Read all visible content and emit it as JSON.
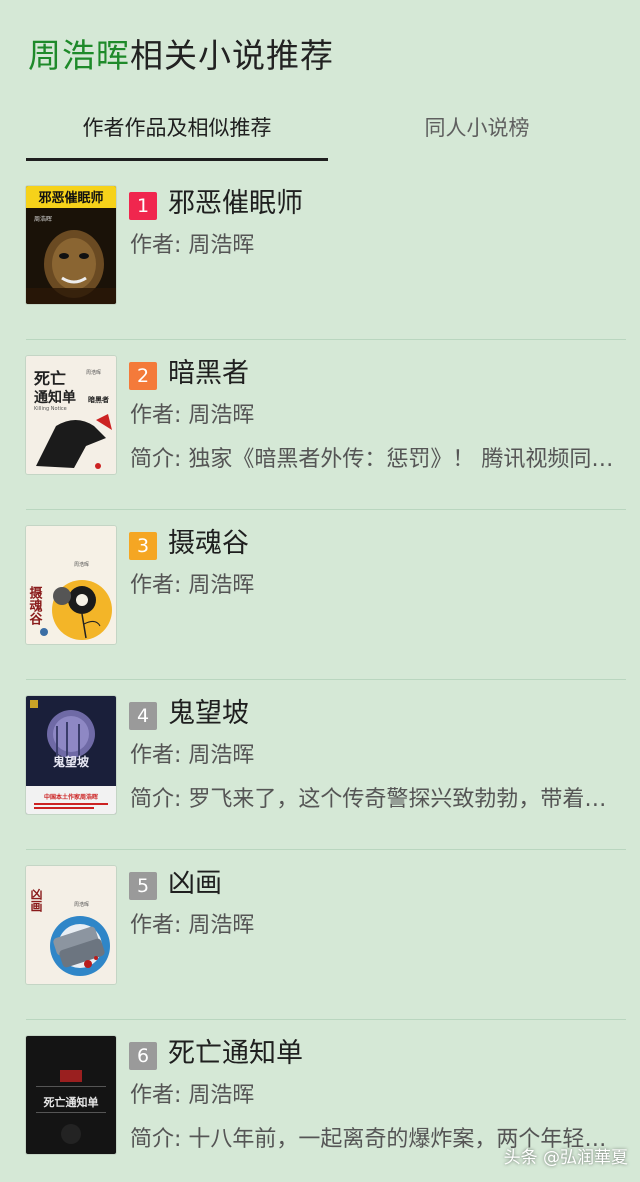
{
  "page_title": {
    "author": "周浩晖",
    "rest": "相关小说推荐"
  },
  "tabs": [
    {
      "label": "作者作品及相似推荐",
      "active": true
    },
    {
      "label": "同人小说榜",
      "active": false
    }
  ],
  "books": [
    {
      "rank": "1",
      "rank_color": "#f0264e",
      "title": "邪恶催眠师",
      "author": "作者: 周浩晖",
      "intro": ""
    },
    {
      "rank": "2",
      "rank_color": "#f47a3a",
      "title": "暗黑者",
      "author": "作者: 周浩晖",
      "intro": "简介: 独家《暗黑者外传：惩罚》！ 腾讯视频同名网剧热播中"
    },
    {
      "rank": "3",
      "rank_color": "#f5a623",
      "title": "摄魂谷",
      "author": "作者: 周浩晖",
      "intro": ""
    },
    {
      "rank": "4",
      "rank_color": "#9a9a9a",
      "title": "鬼望坡",
      "author": "作者: 周浩晖",
      "intro": "简介: 罗飞来了，这个传奇警探兴致勃勃，带着他的新搭档"
    },
    {
      "rank": "5",
      "rank_color": "#9a9a9a",
      "title": "凶画",
      "author": "作者: 周浩晖",
      "intro": ""
    },
    {
      "rank": "6",
      "rank_color": "#9a9a9a",
      "title": "死亡通知单",
      "author": "作者: 周浩晖",
      "intro": "简介: 十八年前，一起离奇的爆炸案，两个年轻警察"
    }
  ],
  "covers": {
    "c1": {
      "title": "邪恶催眠师",
      "author": "周浩晖"
    },
    "c2": {
      "title_a": "死亡",
      "title_b": "通知单",
      "sub": "暗黑者",
      "en": "Killing Notice",
      "author": "周浩晖"
    },
    "c3": {
      "title": "摄魂谷",
      "author": "周浩晖"
    },
    "c4": {
      "title": "鬼望坡",
      "tagline": "中国本土作家周浩晖"
    },
    "c5": {
      "title": "凶画",
      "author": "周浩晖"
    },
    "c6": {
      "title": "死亡通知单"
    }
  },
  "watermark": "头条 @弘润華夏"
}
